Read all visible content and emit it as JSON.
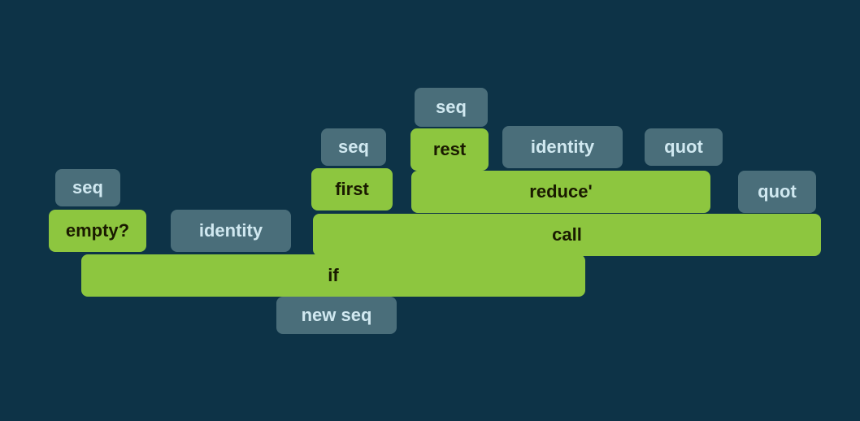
{
  "nodes": {
    "seq_top": {
      "label": "seq"
    },
    "seq_left": {
      "label": "seq"
    },
    "seq_mid": {
      "label": "seq"
    },
    "identity_top": {
      "label": "identity"
    },
    "quot_top": {
      "label": "quot"
    },
    "rest": {
      "label": "rest"
    },
    "empty": {
      "label": "empty?"
    },
    "identity_left": {
      "label": "identity"
    },
    "first": {
      "label": "first"
    },
    "reduce": {
      "label": "reduce'"
    },
    "quot_right": {
      "label": "quot"
    },
    "call": {
      "label": "call"
    },
    "if": {
      "label": "if"
    },
    "new_seq": {
      "label": "new seq"
    }
  }
}
